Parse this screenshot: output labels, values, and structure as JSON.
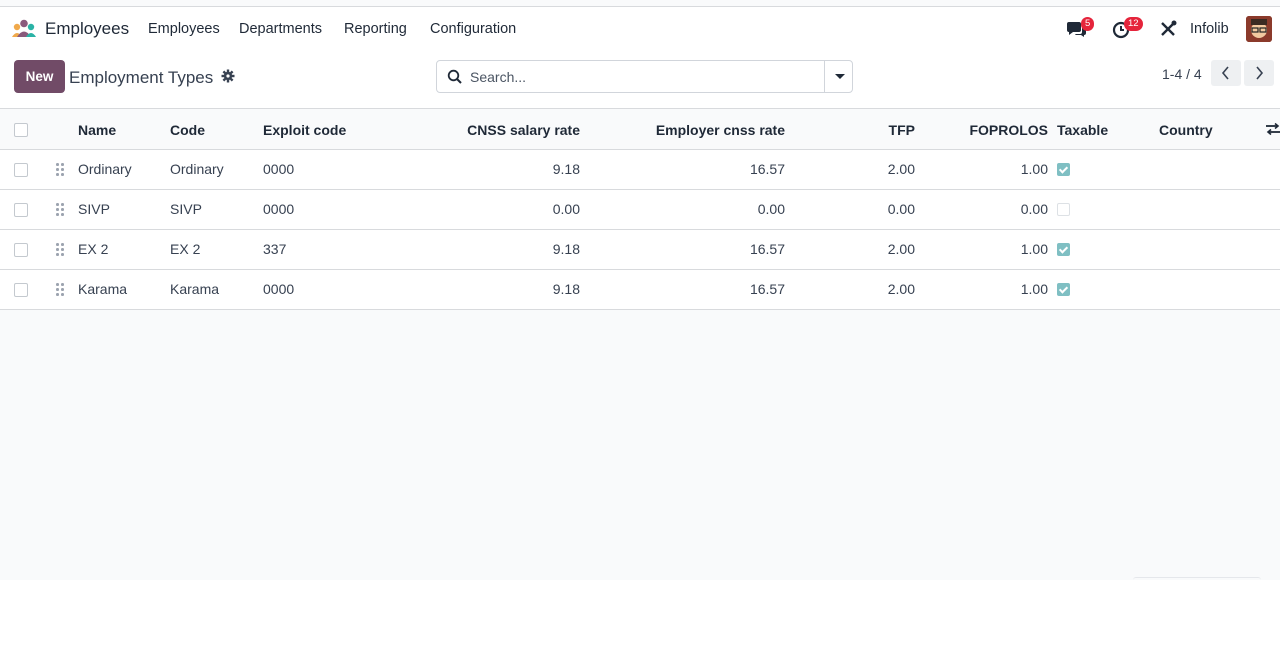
{
  "navbar": {
    "app_name": "Employees",
    "menu": [
      "Employees",
      "Departments",
      "Reporting",
      "Configuration"
    ],
    "messages_count": "5",
    "activities_count": "12",
    "company": "Infolib",
    "icons": [
      "employees-app-icon",
      "chat-icon",
      "clock-icon",
      "tools-icon",
      "avatar"
    ]
  },
  "control_panel": {
    "new_label": "New",
    "title": "Employment Types",
    "search_placeholder": "Search...",
    "pager": "1-4 / 4"
  },
  "table": {
    "headers": {
      "name": "Name",
      "code": "Code",
      "exploit_code": "Exploit code",
      "cnss_salary_rate": "CNSS salary rate",
      "employer_cnss_rate": "Employer cnss rate",
      "tfp": "TFP",
      "foprolos": "FOPROLOS",
      "taxable": "Taxable",
      "country": "Country"
    },
    "rows": [
      {
        "name": "Ordinary",
        "code": "Ordinary",
        "exploit_code": "0000",
        "cnss_salary_rate": "9.18",
        "employer_cnss_rate": "16.57",
        "tfp": "2.00",
        "foprolos": "1.00",
        "taxable": true,
        "country": ""
      },
      {
        "name": "SIVP",
        "code": "SIVP",
        "exploit_code": "0000",
        "cnss_salary_rate": "0.00",
        "employer_cnss_rate": "0.00",
        "tfp": "0.00",
        "foprolos": "0.00",
        "taxable": false,
        "country": ""
      },
      {
        "name": "EX 2",
        "code": "EX 2",
        "exploit_code": "337",
        "cnss_salary_rate": "9.18",
        "employer_cnss_rate": "16.57",
        "tfp": "2.00",
        "foprolos": "1.00",
        "taxable": true,
        "country": ""
      },
      {
        "name": "Karama",
        "code": "Karama",
        "exploit_code": "0000",
        "cnss_salary_rate": "9.18",
        "employer_cnss_rate": "16.57",
        "tfp": "2.00",
        "foprolos": "1.00",
        "taxable": true,
        "country": ""
      }
    ]
  },
  "colors": {
    "primary": "#714b67",
    "badge": "#e5243b",
    "checkbox_checked": "#7fbfc3"
  }
}
